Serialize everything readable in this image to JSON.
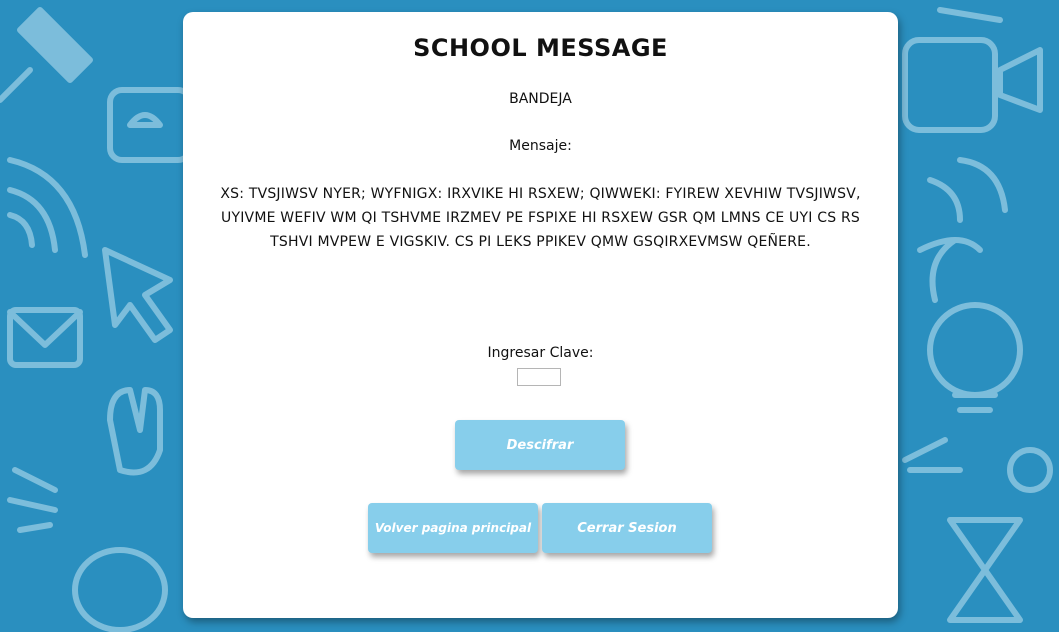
{
  "page": {
    "title": "SCHOOL MESSAGE",
    "inbox_label": "BANDEJA",
    "message_label": "Mensaje:",
    "message_text": "XS: TVSJIWSV NYER; WYFNIGX: IRXVIKE HI RSXEW; QIWWEKI: FYIREW XEVHIW TVSJIWSV, UYIVME WEFIV WM QI TSHVME IRZMEV PE FSPIXE HI RSXEW GSR QM LMNS CE UYI CS RS TSHVI MVPEW E VIGSKIV. CS PI LEKS PPIKEV QMW GSQIRXEVMSW QEÑERE.",
    "key_label": "Ingresar Clave:",
    "key_value": ""
  },
  "buttons": {
    "decrypt": "Descifrar",
    "back_home": "Volver pagina principal",
    "logout": "Cerrar Sesion"
  },
  "colors": {
    "background": "#2a8fbf",
    "card": "#ffffff",
    "button": "#87ceeb",
    "button_text": "#ffffff"
  },
  "background_image": {
    "icon_names": [
      "pushpin-icon",
      "enter-key-icon",
      "wifi-icon",
      "cursor-arrow-icon",
      "envelope-icon",
      "hand-icon",
      "ok-bubble-icon",
      "megaphone-icon",
      "lightbulb-icon",
      "hourglass-icon"
    ]
  }
}
